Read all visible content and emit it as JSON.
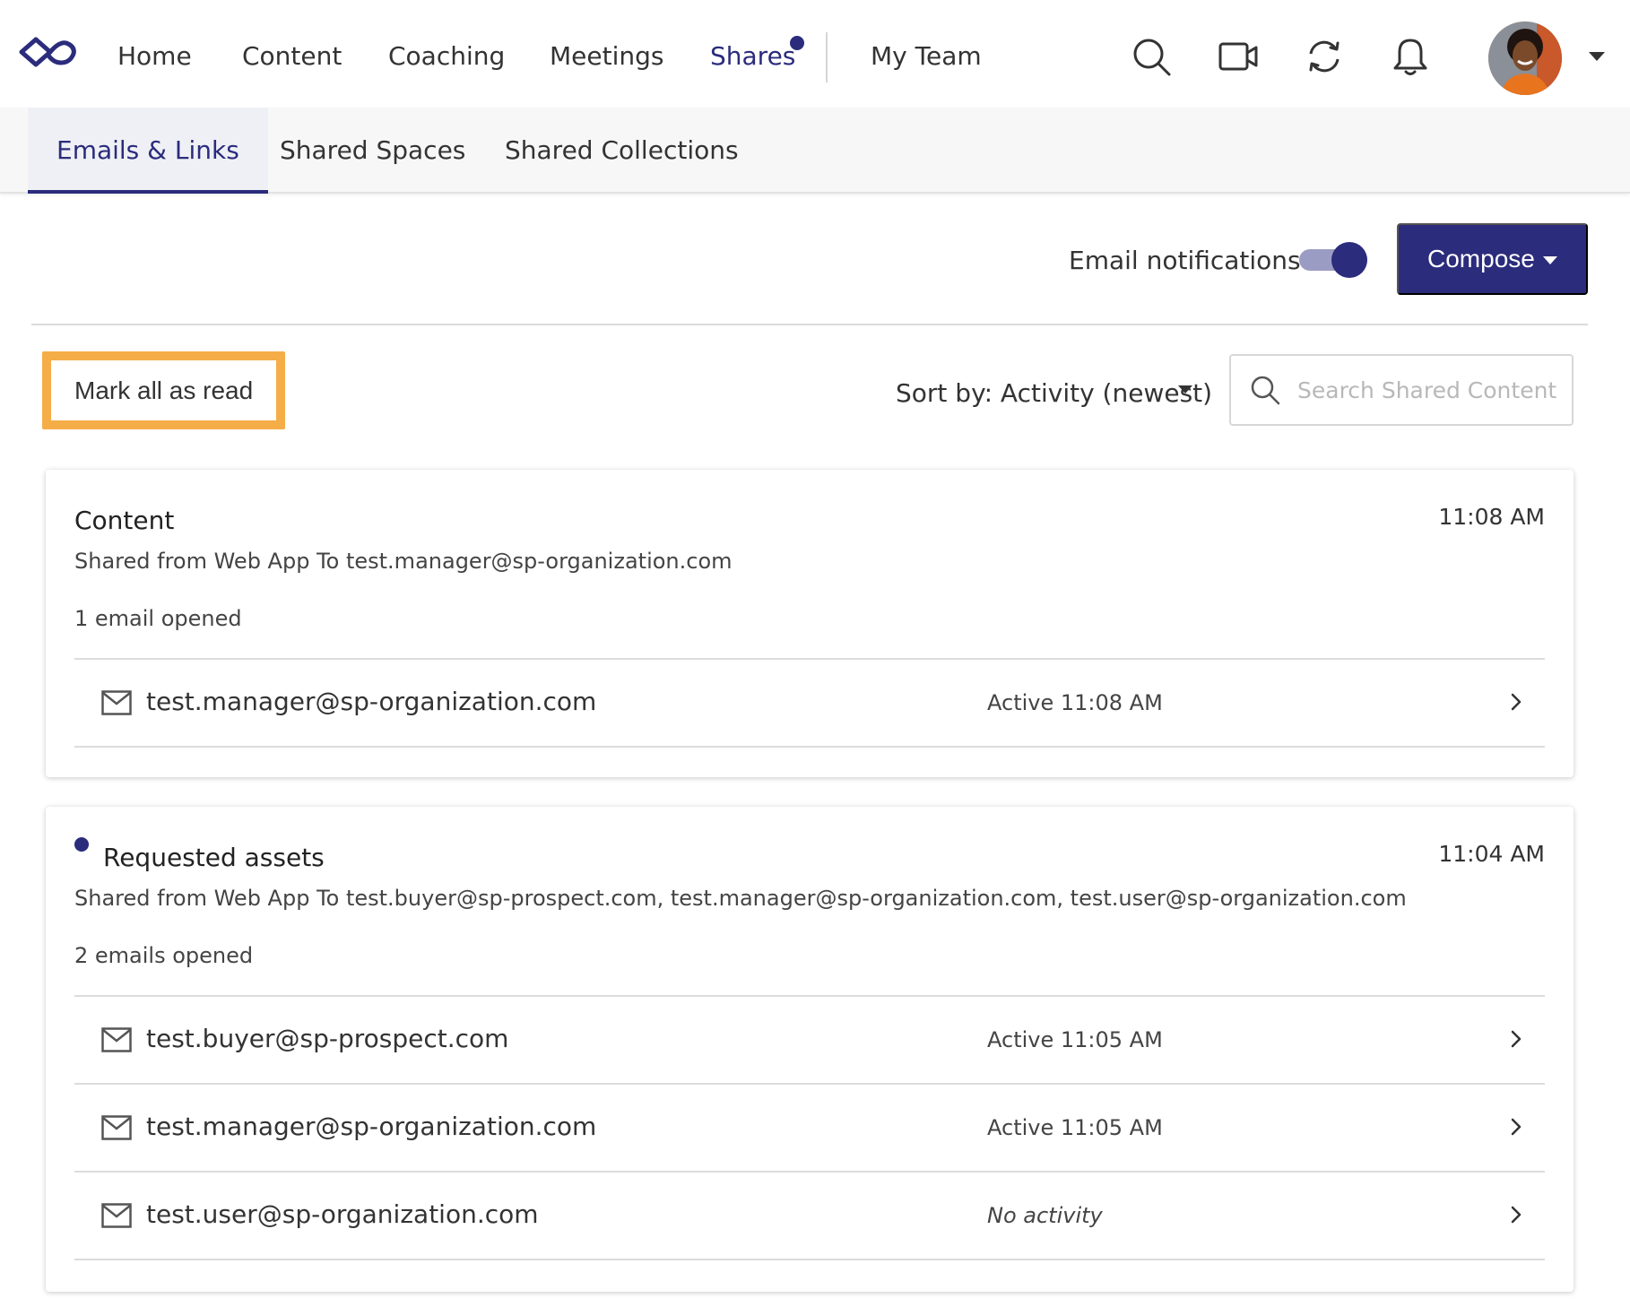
{
  "nav": {
    "items": [
      {
        "label": "Home"
      },
      {
        "label": "Content"
      },
      {
        "label": "Coaching"
      },
      {
        "label": "Meetings"
      },
      {
        "label": "Shares"
      },
      {
        "label": "My Team"
      }
    ],
    "icons": [
      "search-icon",
      "video-icon",
      "sync-icon",
      "bell-icon"
    ],
    "accent_color": "#2b2c7c"
  },
  "subtabs": [
    {
      "label": "Emails & Links"
    },
    {
      "label": "Shared Spaces"
    },
    {
      "label": "Shared Collections"
    }
  ],
  "toolbar": {
    "email_notifications_label": "Email notifications",
    "email_notifications_on": true,
    "compose_label": "Compose",
    "mark_all_read_label": "Mark all as read",
    "sort_label": "Sort by: Activity (newest)",
    "search_placeholder": "Search Shared Content"
  },
  "cards": [
    {
      "title": "Content",
      "time": "11:08 AM",
      "shared_line": "Shared from Web App To test.manager@sp-organization.com",
      "opened_summary": "1 email opened",
      "unread": false,
      "recipients": [
        {
          "email": "test.manager@sp-organization.com",
          "status": "Active 11:08 AM"
        }
      ]
    },
    {
      "title": "Requested assets",
      "time": "11:04 AM",
      "shared_line": "Shared from Web App To test.buyer@sp-prospect.com, test.manager@sp-organization.com, test.user@sp-organization.com",
      "opened_summary": "2 emails opened",
      "unread": true,
      "recipients": [
        {
          "email": "test.buyer@sp-prospect.com",
          "status": "Active 11:05 AM"
        },
        {
          "email": "test.manager@sp-organization.com",
          "status": "Active 11:05 AM"
        },
        {
          "email": "test.user@sp-organization.com",
          "status": "No activity"
        }
      ]
    }
  ]
}
